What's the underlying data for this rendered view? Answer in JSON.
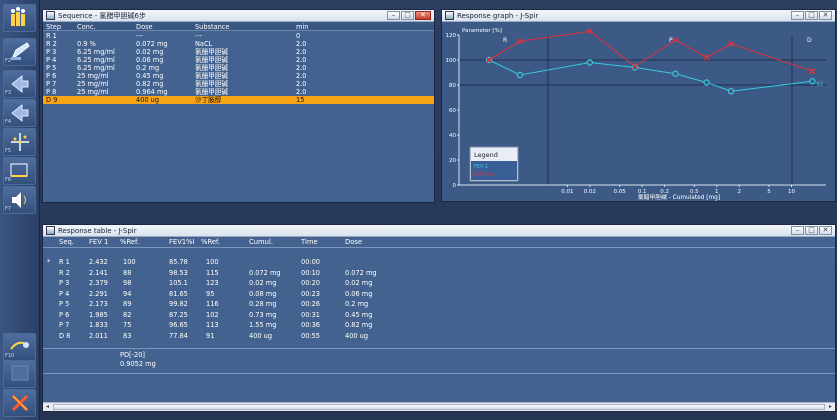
{
  "colors": {
    "accent_row": "#f7a415",
    "fev_series": "#38c8e0",
    "fev1_pct_series": "#e0303a",
    "panel_bg": "#44628f"
  },
  "toolbar": {
    "buttons": [
      {
        "icon": "team-icon",
        "key": ""
      },
      {
        "icon": "edit-pen-icon",
        "key": "F2"
      },
      {
        "icon": "arrow-icon",
        "key": "F3"
      },
      {
        "icon": "arrow-icon",
        "key": "F4"
      },
      {
        "icon": "graph-icon",
        "key": "F5"
      },
      {
        "icon": "chart-tool-icon",
        "key": "F6"
      },
      {
        "icon": "speaker-icon",
        "key": "F7"
      },
      {
        "icon": "spirometer-icon",
        "key": "F10"
      },
      {
        "icon": "blank-icon",
        "key": ""
      },
      {
        "icon": "exit-icon",
        "key": ""
      }
    ]
  },
  "sequence": {
    "title": "Sequence - 氯醋甲胆碱6步",
    "headers": {
      "step": "Step",
      "conc": "Conc.",
      "dose": "Dose",
      "substance": "Substance",
      "min": "min"
    },
    "rows": [
      {
        "step": "R 1",
        "conc": "",
        "dose": "---",
        "substance": "---",
        "min": "0"
      },
      {
        "step": "R 2",
        "conc": "0.9 %",
        "dose": "0.072 mg",
        "substance": "NaCL",
        "min": "2.0"
      },
      {
        "step": "P 3",
        "conc": "6.25 mg/ml",
        "dose": "0.02 mg",
        "substance": "氯醋甲胆碱",
        "min": "2.0"
      },
      {
        "step": "P 4",
        "conc": "6.25 mg/ml",
        "dose": "0.06 mg",
        "substance": "氯醋甲胆碱",
        "min": "2.0"
      },
      {
        "step": "P 5",
        "conc": "6.25 mg/ml",
        "dose": "0.2 mg",
        "substance": "氯醋甲胆碱",
        "min": "2.0"
      },
      {
        "step": "P 6",
        "conc": "25 mg/ml",
        "dose": "0.45 mg",
        "substance": "氯醋甲胆碱",
        "min": "2.0"
      },
      {
        "step": "P 7",
        "conc": "25 mg/ml",
        "dose": "0.82 mg",
        "substance": "氯醋甲胆碱",
        "min": "2.0"
      },
      {
        "step": "P 8",
        "conc": "25 mg/ml",
        "dose": "0.964 mg",
        "substance": "氯醋甲胆碱",
        "min": "2.0"
      },
      {
        "step": "D 9",
        "conc": "",
        "dose": "400 ug",
        "substance": "沙丁胺醇",
        "min": "15"
      }
    ]
  },
  "graph": {
    "title": "Response graph - J-Spir",
    "ylabel": "Parameter [%]",
    "xlabel": "氯醋甲胆碱 - Cumulated [mg]",
    "phase_labels": [
      "R",
      "P",
      "D"
    ],
    "ytick_labels": [
      "0",
      "20",
      "40",
      "60",
      "80",
      "100",
      "120"
    ],
    "xtick_labels": [
      "0.01",
      "0.02",
      "0.05",
      "0.1",
      "0.2",
      "0.5",
      "1",
      "2",
      "5",
      "10"
    ],
    "legend_title": "Legend",
    "legend_items": [
      "FEV 1",
      "FEV1%I"
    ],
    "point_label": "92"
  },
  "chart_data": {
    "type": "line",
    "ylabel": "Parameter [%]",
    "xlabel": "氯醋甲胆碱 - Cumulated [mg]",
    "ylim": [
      0,
      120
    ],
    "x_scale": "log",
    "xlim": [
      0.0055,
      20
    ],
    "x_ticks": [
      0.01,
      0.02,
      0.05,
      0.1,
      0.2,
      0.5,
      1,
      2,
      5,
      10
    ],
    "grid": false,
    "legend_position": "bottom-left",
    "series": [
      {
        "name": "FEV 1",
        "marker": "circle",
        "points": [
          [
            "R1",
            100
          ],
          [
            "R2",
            88
          ],
          [
            0.02,
            98
          ],
          [
            0.08,
            94
          ],
          [
            0.28,
            89
          ],
          [
            0.73,
            82
          ],
          [
            1.55,
            75
          ],
          [
            19,
            83
          ]
        ]
      },
      {
        "name": "FEV1%I",
        "marker": "x",
        "points": [
          [
            "R1",
            100
          ],
          [
            "R2",
            115
          ],
          [
            0.02,
            123
          ],
          [
            0.08,
            95
          ],
          [
            0.28,
            116
          ],
          [
            0.73,
            102
          ],
          [
            1.55,
            113
          ],
          [
            19,
            91
          ]
        ]
      }
    ]
  },
  "response_table": {
    "title": "Response table - J-Spir",
    "headers": {
      "seq": "Seq.",
      "fev1": "FEV 1",
      "ref": "%Ref.",
      "fev1pi": "FEV1%I",
      "ref2": "%Ref.",
      "cumul": "Cumul.",
      "time": "Time",
      "dose": "Dose"
    },
    "rows": [
      {
        "mark": "*",
        "seq": "R 1",
        "fev1": "2.432",
        "ref": "100",
        "fev1pi": "85.78",
        "ref2": "100",
        "cumul": "",
        "time": "00:00",
        "dose": ""
      },
      {
        "mark": "",
        "seq": "R 2",
        "fev1": "2.141",
        "ref": "88",
        "fev1pi": "98.53",
        "ref2": "115",
        "cumul": "0.072 mg",
        "time": "00:10",
        "dose": "0.072 mg"
      },
      {
        "mark": "",
        "seq": "P 3",
        "fev1": "2.379",
        "ref": "98",
        "fev1pi": "105.1",
        "ref2": "123",
        "cumul": "0.02 mg",
        "time": "00:20",
        "dose": "0.02 mg"
      },
      {
        "mark": "",
        "seq": "P 4",
        "fev1": "2.291",
        "ref": "94",
        "fev1pi": "81.65",
        "ref2": "95",
        "cumul": "0.08 mg",
        "time": "00:23",
        "dose": "0.06 mg"
      },
      {
        "mark": "",
        "seq": "P 5",
        "fev1": "2.173",
        "ref": "89",
        "fev1pi": "99.82",
        "ref2": "116",
        "cumul": "0.28 mg",
        "time": "00:26",
        "dose": "0.2 mg"
      },
      {
        "mark": "",
        "seq": "P 6",
        "fev1": "1.985",
        "ref": "82",
        "fev1pi": "87.25",
        "ref2": "102",
        "cumul": "0.73 mg",
        "time": "00:31",
        "dose": "0.45 mg"
      },
      {
        "mark": "",
        "seq": "P 7",
        "fev1": "1.833",
        "ref": "75",
        "fev1pi": "96.65",
        "ref2": "113",
        "cumul": "1.55 mg",
        "time": "00:36",
        "dose": "0.82 mg"
      },
      {
        "mark": "",
        "seq": "D 8",
        "fev1": "2.011",
        "ref": "83",
        "fev1pi": "77.84",
        "ref2": "91",
        "cumul": "400 ug",
        "time": "00:55",
        "dose": "400 ug"
      }
    ],
    "pd_label": "PD[-20]",
    "pd_value": "0.9052 mg"
  }
}
